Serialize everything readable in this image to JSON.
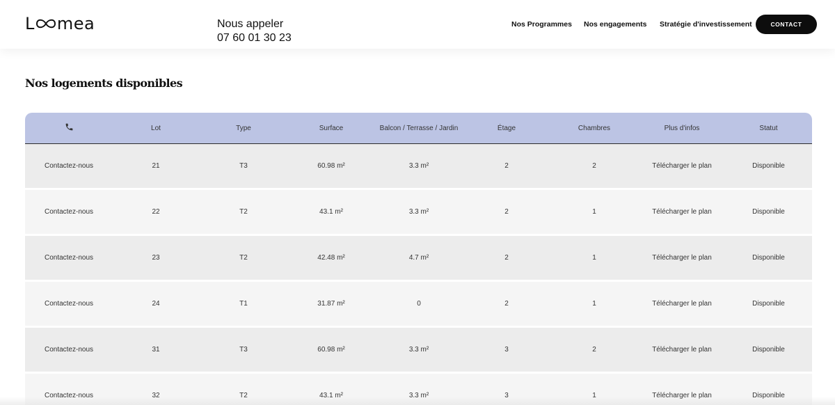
{
  "header": {
    "logo_left": "L",
    "logo_right": "mea",
    "phone_label": "Nous appeler",
    "phone_number": "07 60 01 30 23",
    "nav": [
      {
        "label": "Nos Programmes"
      },
      {
        "label": "Nos engagements"
      },
      {
        "label": "Stratégie d'investissement"
      }
    ],
    "contact_label": "CONTACT"
  },
  "section": {
    "title": "Nos logements disponibles"
  },
  "table": {
    "icon": "phone-icon",
    "columns": [
      "Lot",
      "Type",
      "Surface",
      "Balcon / Terrasse / Jardin",
      "Étage",
      "Chambres",
      "Plus d'infos",
      "Statut"
    ],
    "rows": [
      {
        "contact": "Contactez-nous",
        "lot": "21",
        "type": "T3",
        "surface": "60.98 m²",
        "exterior": "3.3 m²",
        "floor": "2",
        "bedrooms": "2",
        "info": "Télécharger le plan",
        "status": "Disponible"
      },
      {
        "contact": "Contactez-nous",
        "lot": "22",
        "type": "T2",
        "surface": "43.1 m²",
        "exterior": "3.3 m²",
        "floor": "2",
        "bedrooms": "1",
        "info": "Télécharger le plan",
        "status": "Disponible"
      },
      {
        "contact": "Contactez-nous",
        "lot": "23",
        "type": "T2",
        "surface": "42.48 m²",
        "exterior": "4.7 m²",
        "floor": "2",
        "bedrooms": "1",
        "info": "Télécharger le plan",
        "status": "Disponible"
      },
      {
        "contact": "Contactez-nous",
        "lot": "24",
        "type": "T1",
        "surface": "31.87 m²",
        "exterior": "0",
        "floor": "2",
        "bedrooms": "1",
        "info": "Télécharger le plan",
        "status": "Disponible"
      },
      {
        "contact": "Contactez-nous",
        "lot": "31",
        "type": "T3",
        "surface": "60.98 m²",
        "exterior": "3.3 m²",
        "floor": "3",
        "bedrooms": "2",
        "info": "Télécharger le plan",
        "status": "Disponible"
      },
      {
        "contact": "Contactez-nous",
        "lot": "32",
        "type": "T2",
        "surface": "43.1 m²",
        "exterior": "3.3 m²",
        "floor": "3",
        "bedrooms": "1",
        "info": "Télécharger le plan",
        "status": "Disponible"
      }
    ]
  },
  "colors": {
    "header_bg": "#bcc4e4",
    "accent_link": "#e3894f",
    "button_bg": "#0d0d0d"
  }
}
